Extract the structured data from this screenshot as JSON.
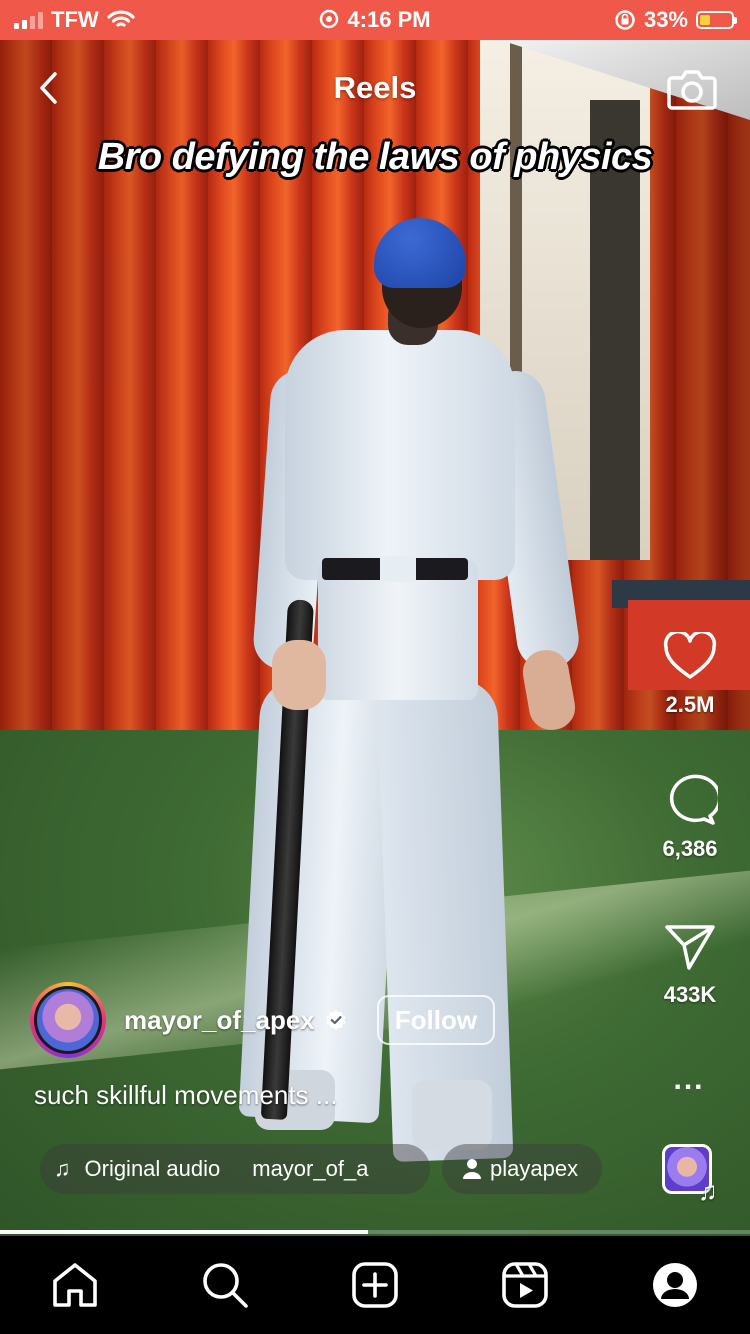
{
  "status_bar": {
    "carrier": "TFW",
    "time": "4:16 PM",
    "battery_percent": "33%",
    "battery_level": 0.33,
    "signal_bars_filled": 2,
    "background_color": "#f0584a"
  },
  "header": {
    "title": "Reels",
    "back_icon": "chevron-left-icon",
    "camera_icon": "camera-icon"
  },
  "video": {
    "caption": "Bro defying the laws of physics",
    "progress": 0.49
  },
  "actions": {
    "likes": "2.5M",
    "comments": "6,386",
    "shares": "433K",
    "more_label": "..."
  },
  "author": {
    "username": "mayor_of_apex",
    "verified": true,
    "follow_label": "Follow"
  },
  "description": "such skillful movements ...",
  "audio": {
    "label": "Original audio",
    "artist": "mayor_of_a",
    "tagged_user": "playapex"
  },
  "bottom_nav": [
    "home-icon",
    "search-icon",
    "create-icon",
    "reels-icon",
    "profile-icon"
  ]
}
